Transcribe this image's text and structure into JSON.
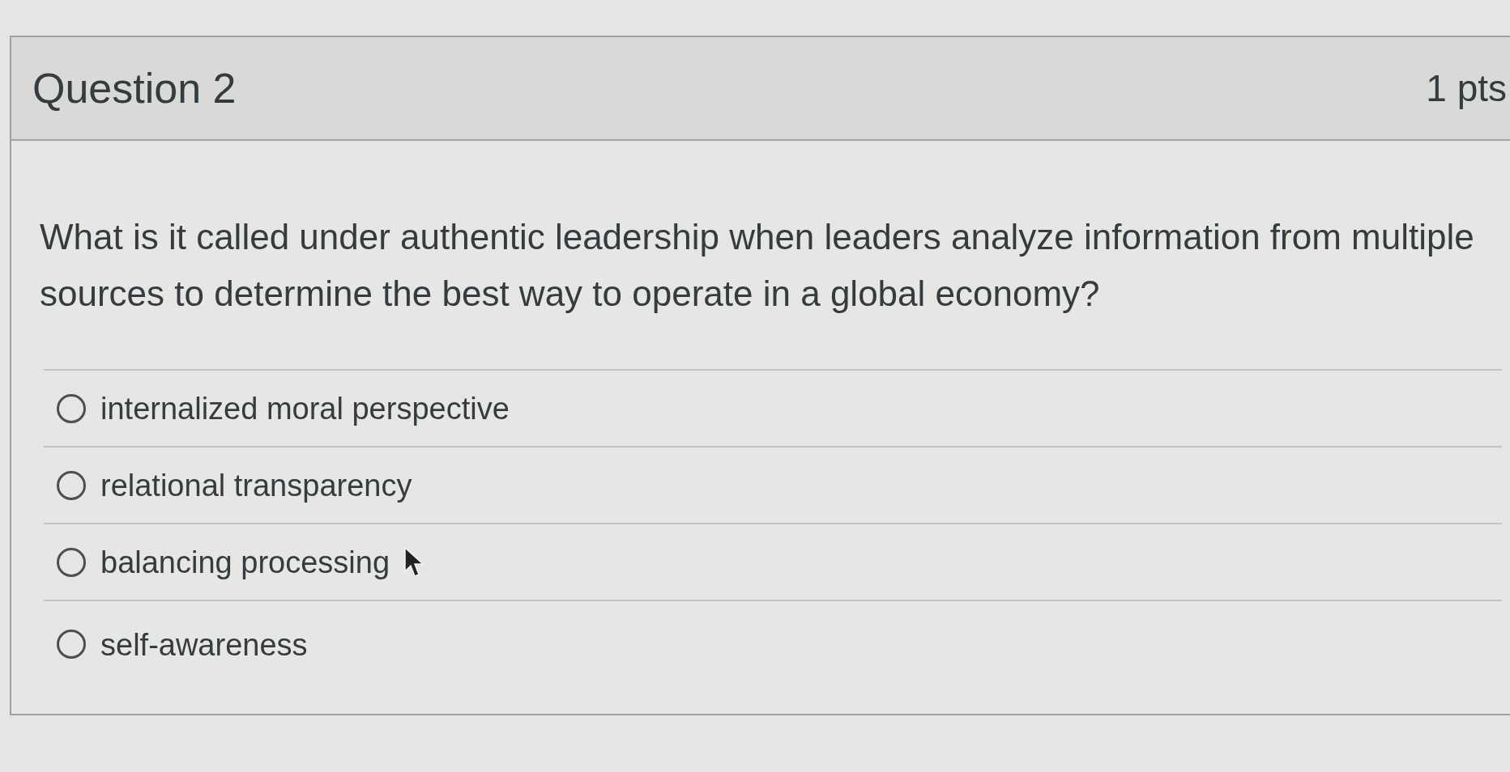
{
  "question": {
    "title": "Question 2",
    "points": "1 pts"
  },
  "prompt": "What is it called under authentic leadership when leaders analyze information from multiple sources to determine the best way to operate in a global economy?",
  "answers": [
    {
      "label": "internalized moral perspective",
      "selected": false
    },
    {
      "label": "relational transparency",
      "selected": false
    },
    {
      "label": "balancing processing",
      "selected": false
    },
    {
      "label": "self-awareness",
      "selected": false
    }
  ]
}
